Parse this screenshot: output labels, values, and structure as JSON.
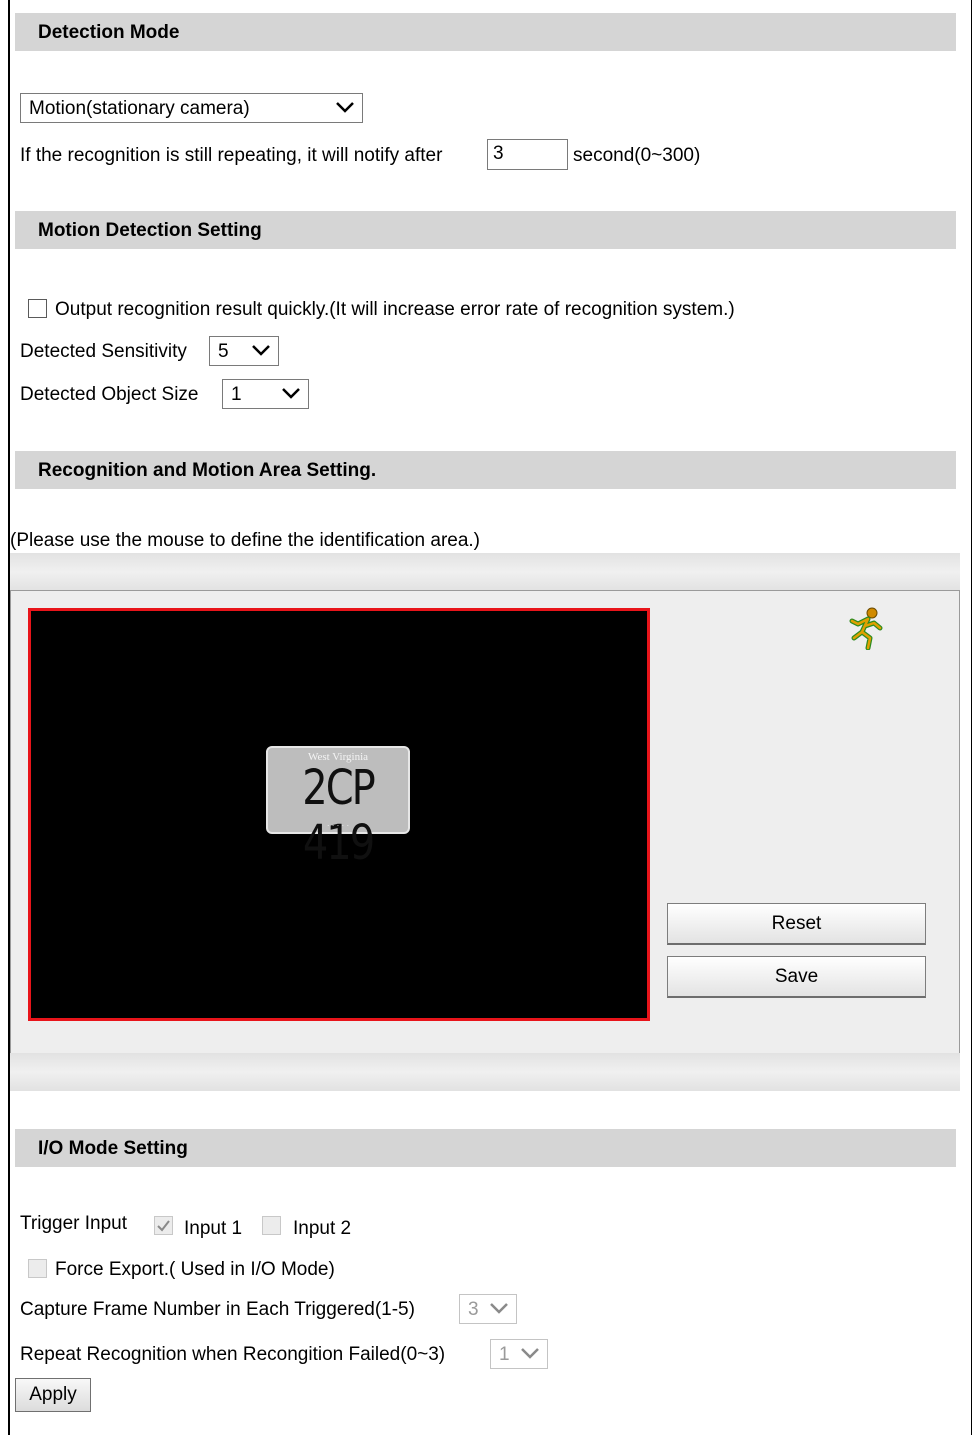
{
  "detection_mode": {
    "header": "Detection Mode",
    "mode_selected": "Motion(stationary camera)",
    "notify_prefix": "If the recognition is still repeating, it will notify after",
    "notify_value": "3",
    "notify_suffix": "second(0~300)"
  },
  "motion_setting": {
    "header": "Motion Detection Setting",
    "quick_output_label": "Output recognition result quickly.(It will increase error rate of recognition system.)",
    "quick_output_checked": false,
    "sensitivity_label": "Detected Sensitivity",
    "sensitivity_value": "5",
    "object_size_label": "Detected Object Size",
    "object_size_value": "1"
  },
  "area_setting": {
    "header": "Recognition and Motion Area Setting.",
    "instruction": "(Please use the mouse to define the identification area.)",
    "plate_state": "West Virginia",
    "plate_number": "2CP 419",
    "reset_label": "Reset",
    "save_label": "Save",
    "motion_icon": "running-man-icon",
    "area_border_color": "#e8141a"
  },
  "io_setting": {
    "header": "I/O Mode Setting",
    "trigger_label": "Trigger Input",
    "input1_label": "Input 1",
    "input1_checked": true,
    "input2_label": "Input 2",
    "input2_checked": false,
    "force_export_label": "Force Export.( Used in I/O Mode)",
    "capture_label": "Capture Frame Number in Each Triggered(1-5)",
    "capture_value": "3",
    "repeat_label": "Repeat Recognition when Recongition Failed(0~3)",
    "repeat_value": "1"
  },
  "apply_label": "Apply"
}
